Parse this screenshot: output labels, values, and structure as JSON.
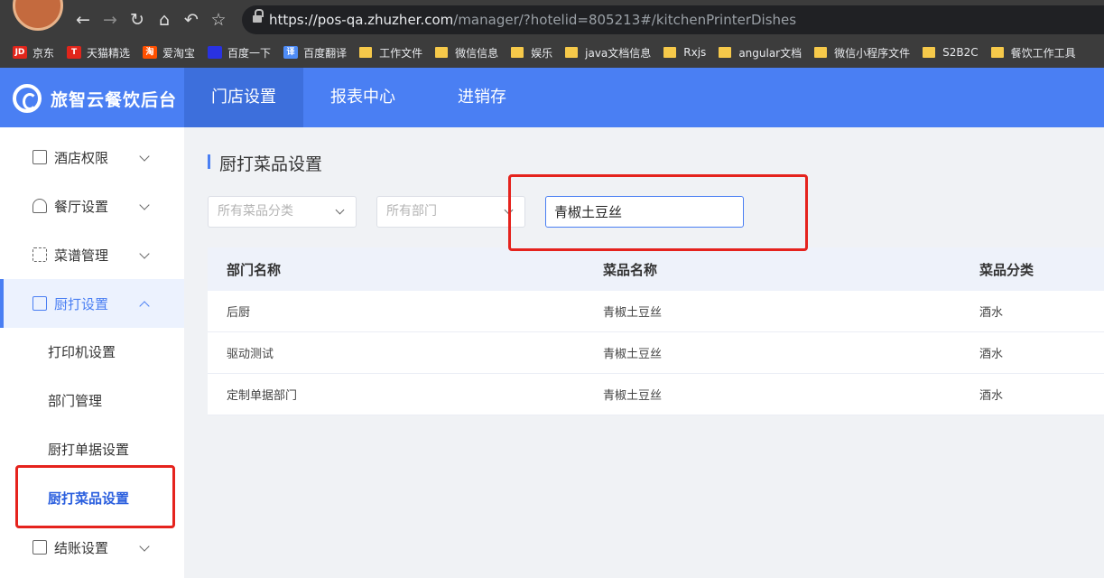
{
  "browser": {
    "url_host": "https://pos-qa.zhuzher.com",
    "url_path": "/manager/?hotelid=805213#/kitchenPrinterDishes",
    "bookmarks": [
      "京东",
      "天猫精选",
      "爱淘宝",
      "百度一下",
      "百度翻译",
      "工作文件",
      "微信信息",
      "娱乐",
      "java文档信息",
      "Rxjs",
      "angular文档",
      "微信小程序文件",
      "S2B2C",
      "餐饮工作工具"
    ],
    "bookmark_badges": [
      "JD",
      "T",
      "淘",
      "",
      "译"
    ]
  },
  "app": {
    "logo_text": "旅智云餐饮后台",
    "tabs": [
      "门店设置",
      "报表中心",
      "进销存"
    ]
  },
  "sidebar": {
    "menus": [
      "酒店权限",
      "餐厅设置",
      "菜谱管理",
      "厨打设置",
      "结账设置"
    ],
    "submenu": [
      "打印机设置",
      "部门管理",
      "厨打单据设置",
      "厨打菜品设置"
    ]
  },
  "page": {
    "title": "厨打菜品设置",
    "filters": {
      "category_placeholder": "所有菜品分类",
      "department_placeholder": "所有部门",
      "search_value": "青椒土豆丝"
    },
    "table": {
      "headers": [
        "部门名称",
        "菜品名称",
        "菜品分类"
      ],
      "rows": [
        [
          "后厨",
          "青椒土豆丝",
          "酒水"
        ],
        [
          "驱动测试",
          "青椒土豆丝",
          "酒水"
        ],
        [
          "定制单据部门",
          "青椒土豆丝",
          "酒水"
        ]
      ]
    }
  },
  "colors": {
    "accent": "#4a7ff3",
    "highlight": "#e5231d"
  }
}
